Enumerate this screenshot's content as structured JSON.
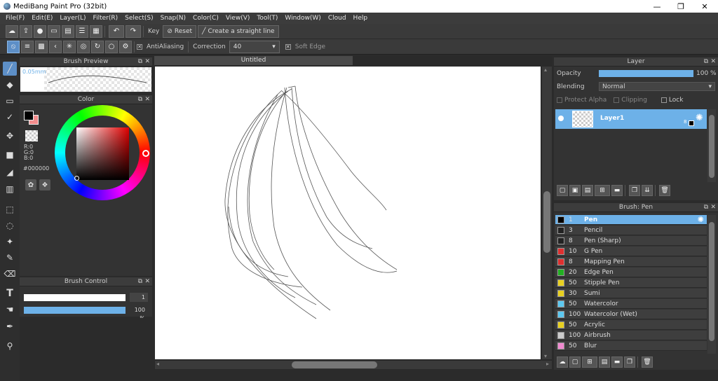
{
  "window": {
    "title": "MediBang Paint Pro (32bit)",
    "controls": [
      "—",
      "❐",
      "✕"
    ]
  },
  "menu": [
    "File(F)",
    "Edit(E)",
    "Layer(L)",
    "Filter(R)",
    "Select(S)",
    "Snap(N)",
    "Color(C)",
    "View(V)",
    "Tool(T)",
    "Window(W)",
    "Cloud",
    "Help"
  ],
  "toolbar": {
    "key_label": "Key",
    "reset_label": "Reset",
    "straight_line_label": "Create a straight line"
  },
  "toolbar2": {
    "antialias_label": "AntiAliasing",
    "correction_label": "Correction",
    "correction_value": "40",
    "soft_edge_label": "Soft Edge",
    "antialias_mark": "✕",
    "soft_edge_mark": "✕"
  },
  "brush_preview": {
    "title": "Brush Preview",
    "size_label": "0.05mm"
  },
  "color_panel": {
    "title": "Color",
    "r": "R:0",
    "g": "G:0",
    "b": "B:0",
    "hex": "#000000",
    "primary": "#000000",
    "secondary": "#f28c8c"
  },
  "brush_control": {
    "title": "Brush Control",
    "size_value": "1",
    "opacity_value": "100 %"
  },
  "document": {
    "title": "Untitled"
  },
  "layer_panel": {
    "title": "Layer",
    "opacity_label": "Opacity",
    "opacity_value": "100 %",
    "blending_label": "Blending",
    "blending_value": "Normal",
    "protect_alpha": "Protect Alpha",
    "clipping": "Clipping",
    "lock": "Lock",
    "layer_name": "Layer1",
    "layer_badge": "8"
  },
  "brush_panel": {
    "title": "Brush: Pen",
    "items": [
      {
        "size": "1",
        "name": "Pen",
        "color": "#000000",
        "selected": true
      },
      {
        "size": "3",
        "name": "Pencil",
        "color": "#222222"
      },
      {
        "size": "8",
        "name": "Pen (Sharp)",
        "color": "#222222"
      },
      {
        "size": "10",
        "name": "G Pen",
        "color": "#e03030"
      },
      {
        "size": "8",
        "name": "Mapping Pen",
        "color": "#e03030"
      },
      {
        "size": "20",
        "name": "Edge Pen",
        "color": "#22b022"
      },
      {
        "size": "50",
        "name": "Stipple Pen",
        "color": "#e8d020"
      },
      {
        "size": "30",
        "name": "Sumi",
        "color": "#e8d020"
      },
      {
        "size": "50",
        "name": "Watercolor",
        "color": "#5cc8f0"
      },
      {
        "size": "100",
        "name": "Watercolor (Wet)",
        "color": "#5cc8f0"
      },
      {
        "size": "50",
        "name": "Acrylic",
        "color": "#e8d020"
      },
      {
        "size": "100",
        "name": "Airbrush",
        "color": "#cccccc"
      },
      {
        "size": "50",
        "name": "Blur",
        "color": "#f08ad0"
      }
    ]
  },
  "colors": {
    "accent": "#5d8fc7",
    "selection": "#6db1e8",
    "panel": "#333333"
  }
}
